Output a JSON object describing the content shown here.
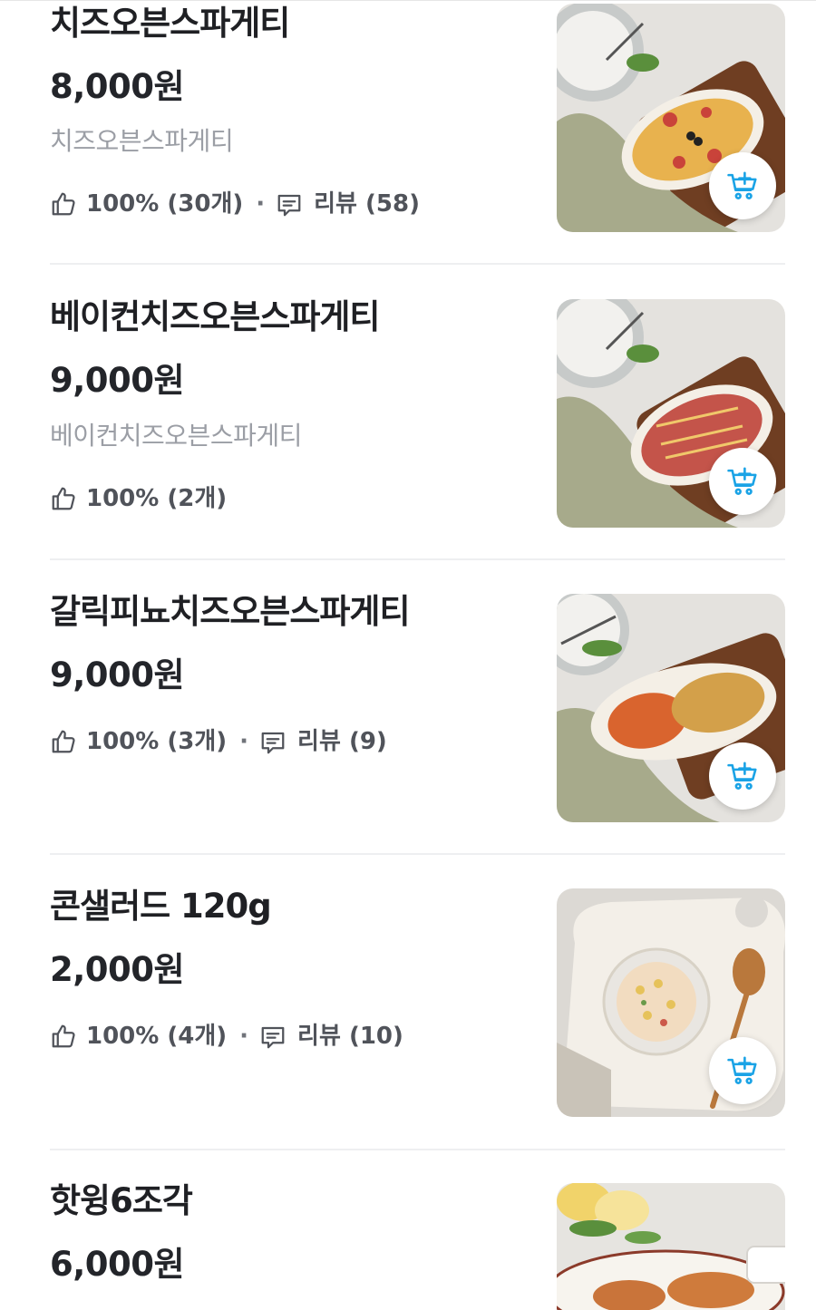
{
  "menu": {
    "items": [
      {
        "name": "치즈오븐스파게티",
        "price": "8,000원",
        "description": "치즈오븐스파게티",
        "like": "100% (30개)",
        "separator": "·",
        "review": "리뷰 (58)",
        "image_icon": "cheese-oven-spaghetti-photo",
        "cart_icon": "add-to-cart-icon"
      },
      {
        "name": "베이컨치즈오븐스파게티",
        "price": "9,000원",
        "description": "베이컨치즈오븐스파게티",
        "like": "100% (2개)",
        "image_icon": "bacon-cheese-oven-spaghetti-photo",
        "cart_icon": "add-to-cart-icon"
      },
      {
        "name": "갈릭피뇨치즈오븐스파게티",
        "price": "9,000원",
        "like": "100% (3개)",
        "separator": "·",
        "review": "리뷰 (9)",
        "image_icon": "garlic-pino-cheese-oven-spaghetti-photo",
        "cart_icon": "add-to-cart-icon"
      },
      {
        "name": "콘샐러드 120g",
        "price": "2,000원",
        "like": "100% (4개)",
        "separator": "·",
        "review": "리뷰 (10)",
        "image_icon": "corn-salad-photo",
        "cart_icon": "add-to-cart-icon"
      },
      {
        "name": "핫윙6조각",
        "price": "6,000원",
        "image_icon": "hot-wings-photo"
      }
    ]
  },
  "colors": {
    "accent": "#1aa3e6",
    "text": "#1f2024",
    "muted": "#9b9ea5",
    "meta": "#50535a"
  }
}
